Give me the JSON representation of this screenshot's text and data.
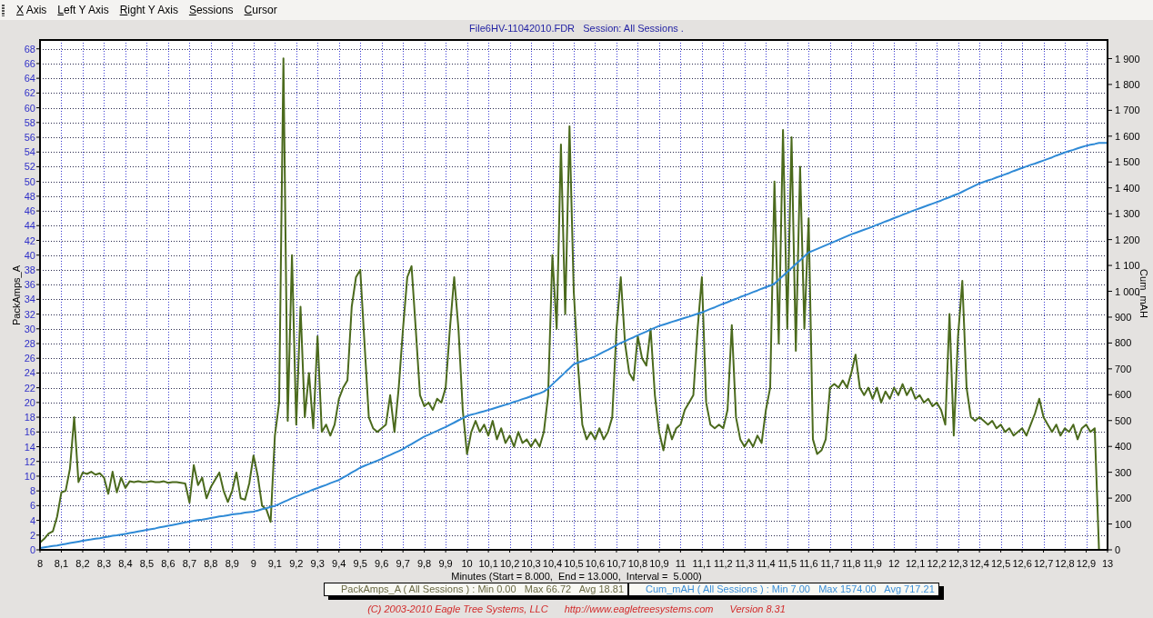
{
  "menu_bar": [
    "X Axis",
    "Left Y Axis",
    "Right Y Axis",
    "Sessions",
    "Cursor"
  ],
  "chart": {
    "chart_data": {
      "type": "line",
      "title": "File6HV-11042010.FDR   Session: All Sessions .",
      "xlabel": "Minutes (Start = 8.000,  End = 13.000,  Interval =  5.000)",
      "ylabel": "PackAmps_A",
      "y2label": "Cum_mAH",
      "grid": true,
      "xlim": [
        8,
        13
      ],
      "ylim": [
        0,
        69.2
      ],
      "y2lim": [
        0,
        1972
      ],
      "xticks": [
        8,
        {
          "value": 8.1,
          "label": "8,1"
        },
        {
          "value": 8.2,
          "label": "8,2"
        },
        {
          "value": 8.3,
          "label": "8,3"
        },
        {
          "value": 8.4,
          "label": "8,4"
        },
        {
          "value": 8.5,
          "label": "8,5"
        },
        {
          "value": 8.6,
          "label": "8,6"
        },
        {
          "value": 8.7,
          "label": "8,7"
        },
        {
          "value": 8.8,
          "label": "8,8"
        },
        {
          "value": 8.9,
          "label": "8,9"
        },
        9,
        {
          "value": 9.1,
          "label": "9,1"
        },
        {
          "value": 9.2,
          "label": "9,2"
        },
        {
          "value": 9.3,
          "label": "9,3"
        },
        {
          "value": 9.4,
          "label": "9,4"
        },
        {
          "value": 9.5,
          "label": "9,5"
        },
        {
          "value": 9.6,
          "label": "9,6"
        },
        {
          "value": 9.7,
          "label": "9,7"
        },
        {
          "value": 9.8,
          "label": "9,8"
        },
        {
          "value": 9.9,
          "label": "9,9"
        },
        10,
        {
          "value": 10.1,
          "label": "10,1"
        },
        {
          "value": 10.2,
          "label": "10,2"
        },
        {
          "value": 10.3,
          "label": "10,3"
        },
        {
          "value": 10.4,
          "label": "10,4"
        },
        {
          "value": 10.5,
          "label": "10,5"
        },
        {
          "value": 10.6,
          "label": "10,6"
        },
        {
          "value": 10.7,
          "label": "10,7"
        },
        {
          "value": 10.8,
          "label": "10,8"
        },
        {
          "value": 10.9,
          "label": "10,9"
        },
        11,
        {
          "value": 11.1,
          "label": "11,1"
        },
        {
          "value": 11.2,
          "label": "11,2"
        },
        {
          "value": 11.3,
          "label": "11,3"
        },
        {
          "value": 11.4,
          "label": "11,4"
        },
        {
          "value": 11.5,
          "label": "11,5"
        },
        {
          "value": 11.6,
          "label": "11,6"
        },
        {
          "value": 11.7,
          "label": "11,7"
        },
        {
          "value": 11.8,
          "label": "11,8"
        },
        {
          "value": 11.9,
          "label": "11,9"
        },
        12,
        {
          "value": 12.1,
          "label": "12,1"
        },
        {
          "value": 12.2,
          "label": "12,2"
        },
        {
          "value": 12.3,
          "label": "12,3"
        },
        {
          "value": 12.4,
          "label": "12,4"
        },
        {
          "value": 12.5,
          "label": "12,5"
        },
        {
          "value": 12.6,
          "label": "12,6"
        },
        {
          "value": 12.7,
          "label": "12,7"
        },
        {
          "value": 12.8,
          "label": "12,8"
        },
        {
          "value": 12.9,
          "label": "12,9"
        },
        13
      ],
      "yticks": [
        0,
        2,
        4,
        6,
        8,
        10,
        12,
        14,
        16,
        18,
        20,
        22,
        24,
        26,
        28,
        30,
        32,
        34,
        36,
        38,
        40,
        42,
        44,
        46,
        48,
        50,
        52,
        54,
        56,
        58,
        60,
        62,
        64,
        66,
        68
      ],
      "y2ticks": [
        0,
        100,
        200,
        300,
        400,
        500,
        600,
        700,
        800,
        900,
        {
          "value": 1000,
          "label": "1 000"
        },
        {
          "value": 1100,
          "label": "1 100"
        },
        {
          "value": 1200,
          "label": "1 200"
        },
        {
          "value": 1300,
          "label": "1 300"
        },
        {
          "value": 1400,
          "label": "1 400"
        },
        {
          "value": 1500,
          "label": "1 500"
        },
        {
          "value": 1600,
          "label": "1 600"
        },
        {
          "value": 1700,
          "label": "1 700"
        },
        {
          "value": 1800,
          "label": "1 800"
        },
        {
          "value": 1900,
          "label": "1 900"
        }
      ],
      "x": [
        8,
        8.02,
        8.04,
        8.06,
        8.08,
        8.1,
        8.12,
        8.14,
        8.16,
        8.18,
        8.2,
        8.22,
        8.24,
        8.26,
        8.28,
        8.3,
        8.32,
        8.34,
        8.36,
        8.38,
        8.4,
        8.42,
        8.44,
        8.46,
        8.48,
        8.5,
        8.52,
        8.54,
        8.56,
        8.58,
        8.6,
        8.62,
        8.64,
        8.66,
        8.68,
        8.7,
        8.72,
        8.74,
        8.76,
        8.78,
        8.8,
        8.82,
        8.84,
        8.86,
        8.88,
        8.9,
        8.92,
        8.94,
        8.96,
        8.98,
        9,
        9.02,
        9.04,
        9.06,
        9.08,
        9.1,
        9.12,
        9.14,
        9.16,
        9.18,
        9.2,
        9.22,
        9.24,
        9.26,
        9.28,
        9.3,
        9.32,
        9.34,
        9.36,
        9.38,
        9.4,
        9.42,
        9.44,
        9.46,
        9.48,
        9.5,
        9.52,
        9.54,
        9.56,
        9.58,
        9.6,
        9.62,
        9.64,
        9.66,
        9.68,
        9.7,
        9.72,
        9.74,
        9.76,
        9.78,
        9.8,
        9.82,
        9.84,
        9.86,
        9.88,
        9.9,
        9.92,
        9.94,
        9.96,
        9.98,
        10,
        10.02,
        10.04,
        10.06,
        10.08,
        10.1,
        10.12,
        10.14,
        10.16,
        10.18,
        10.2,
        10.22,
        10.24,
        10.26,
        10.28,
        10.3,
        10.32,
        10.34,
        10.36,
        10.38,
        10.4,
        10.42,
        10.44,
        10.46,
        10.48,
        10.5,
        10.52,
        10.54,
        10.56,
        10.58,
        10.6,
        10.62,
        10.64,
        10.66,
        10.68,
        10.7,
        10.72,
        10.74,
        10.76,
        10.78,
        10.8,
        10.82,
        10.84,
        10.86,
        10.88,
        10.9,
        10.92,
        10.94,
        10.96,
        10.98,
        11,
        11.02,
        11.04,
        11.06,
        11.08,
        11.1,
        11.12,
        11.14,
        11.16,
        11.18,
        11.2,
        11.22,
        11.24,
        11.26,
        11.28,
        11.3,
        11.32,
        11.34,
        11.36,
        11.38,
        11.4,
        11.42,
        11.44,
        11.46,
        11.48,
        11.5,
        11.52,
        11.54,
        11.56,
        11.58,
        11.6,
        11.62,
        11.64,
        11.66,
        11.68,
        11.7,
        11.72,
        11.74,
        11.76,
        11.78,
        11.8,
        11.82,
        11.84,
        11.86,
        11.88,
        11.9,
        11.92,
        11.94,
        11.96,
        11.98,
        12,
        12.02,
        12.04,
        12.06,
        12.08,
        12.1,
        12.12,
        12.14,
        12.16,
        12.18,
        12.2,
        12.22,
        12.24,
        12.26,
        12.28,
        12.3,
        12.32,
        12.34,
        12.36,
        12.38,
        12.4,
        12.42,
        12.44,
        12.46,
        12.48,
        12.5,
        12.52,
        12.54,
        12.56,
        12.58,
        12.6,
        12.62,
        12.64,
        12.66,
        12.68,
        12.7,
        12.72,
        12.74,
        12.76,
        12.78,
        12.8,
        12.82,
        12.84,
        12.86,
        12.88,
        12.9,
        12.92,
        12.94,
        12.96,
        12.98,
        13
      ],
      "series": [
        {
          "color": "#4b6a1d",
          "values": [
            1,
            1.5,
            2.2,
            2.5,
            4.5,
            7.8,
            8,
            11,
            18,
            9.2,
            10.5,
            10.3,
            10.6,
            10.2,
            10.4,
            9.8,
            7.6,
            10.6,
            7.8,
            9.8,
            8.4,
            9.3,
            9.2,
            9.3,
            9.2,
            9.2,
            9.3,
            9.2,
            9.2,
            9.3,
            9.1,
            9.2,
            9.2,
            9.1,
            9,
            6.4,
            11.5,
            8.8,
            9.8,
            7,
            8.5,
            9.5,
            10.5,
            8,
            6.5,
            8,
            10.5,
            7,
            6.8,
            9,
            12.8,
            10,
            6,
            5.5,
            3.8,
            15.5,
            20,
            66.7,
            17.5,
            40,
            17,
            33,
            18,
            24,
            16.5,
            29,
            16,
            17,
            15.5,
            17,
            20.5,
            22,
            23,
            33,
            37,
            38,
            28,
            18,
            16.5,
            16,
            16.5,
            17,
            21,
            16,
            22,
            30,
            37,
            38.5,
            30,
            21,
            19.5,
            20,
            19,
            20.5,
            20,
            22,
            30,
            37,
            30,
            19,
            13,
            16,
            17.5,
            16,
            17,
            15.5,
            17.5,
            15,
            16.5,
            14.5,
            15.5,
            14,
            16,
            14.5,
            15,
            14,
            15,
            14,
            16,
            21,
            40,
            30,
            55,
            32,
            57.5,
            35,
            25,
            17,
            15,
            16,
            15,
            16.5,
            15,
            16,
            18,
            30,
            37,
            28,
            24,
            23,
            29,
            26,
            25,
            30,
            21,
            16,
            13.5,
            17,
            15,
            16.5,
            17,
            19,
            20,
            21,
            30,
            37,
            20,
            17,
            16.5,
            17,
            16.5,
            19,
            30.5,
            18,
            15,
            14,
            15,
            14,
            15.5,
            14.5,
            19,
            22,
            50,
            28,
            57,
            30,
            56,
            27,
            52,
            30,
            45,
            15,
            13,
            13.5,
            15,
            22,
            22.5,
            22,
            23,
            22,
            24,
            26.5,
            22,
            21,
            22,
            20.5,
            22,
            20,
            21.5,
            20.5,
            22,
            21,
            22.5,
            21,
            22,
            20.5,
            21,
            20,
            20.5,
            19.5,
            20,
            19,
            17,
            32,
            15.5,
            29,
            36.5,
            22,
            18,
            17.5,
            18,
            17.5,
            17,
            17.5,
            16.5,
            17,
            16,
            16.5,
            15.5,
            16,
            16.5,
            15.5,
            17,
            18.5,
            20.5,
            18,
            17,
            16,
            17,
            15.5,
            16.5,
            16,
            17,
            15,
            16.5,
            17,
            16,
            16.5,
            0,
            null,
            null
          ]
        },
        {
          "color": "#2f8ad6",
          "axis": "y2",
          "values": [
            7,
            10,
            12,
            15,
            17,
            20,
            23,
            26,
            29,
            32,
            35,
            38,
            40,
            43,
            45,
            48,
            51,
            54,
            56,
            59,
            62,
            65,
            68,
            71,
            74,
            77,
            80,
            83,
            87,
            90,
            93,
            96,
            99,
            103,
            106,
            109,
            112,
            115,
            117,
            120,
            123,
            126,
            129,
            131,
            134,
            137,
            139,
            141,
            144,
            146,
            148,
            152,
            157,
            161,
            166,
            170,
            177,
            185,
            192,
            200,
            207,
            213,
            220,
            226,
            233,
            239,
            245,
            251,
            258,
            264,
            270,
            280,
            289,
            299,
            308,
            318,
            325,
            332,
            338,
            345,
            352,
            360,
            367,
            375,
            382,
            390,
            400,
            409,
            419,
            428,
            438,
            445,
            453,
            460,
            468,
            475,
            484,
            492,
            501,
            509,
            518,
            523,
            527,
            532,
            536,
            541,
            546,
            551,
            556,
            561,
            566,
            572,
            577,
            583,
            588,
            594,
            600,
            605,
            612,
            624,
            640,
            656,
            671,
            687,
            702,
            718,
            724,
            730,
            736,
            742,
            748,
            757,
            766,
            774,
            783,
            792,
            800,
            807,
            815,
            822,
            830,
            837,
            844,
            852,
            859,
            866,
            871,
            876,
            882,
            887,
            892,
            897,
            902,
            908,
            913,
            918,
            925,
            932,
            938,
            945,
            952,
            958,
            965,
            971,
            978,
            984,
            990,
            997,
            1003,
            1010,
            1016,
            1022,
            1030,
            1045,
            1060,
            1075,
            1090,
            1105,
            1120,
            1135,
            1150,
            1157,
            1164,
            1171,
            1178,
            1185,
            1192,
            1199,
            1206,
            1213,
            1220,
            1226,
            1232,
            1238,
            1244,
            1250,
            1257,
            1263,
            1270,
            1276,
            1283,
            1289,
            1296,
            1302,
            1309,
            1315,
            1321,
            1327,
            1333,
            1339,
            1345,
            1351,
            1358,
            1364,
            1371,
            1377,
            1385,
            1393,
            1401,
            1409,
            1417,
            1423,
            1429,
            1434,
            1440,
            1446,
            1452,
            1458,
            1465,
            1471,
            1477,
            1483,
            1489,
            1494,
            1500,
            1506,
            1512,
            1518,
            1525,
            1531,
            1537,
            1542,
            1547,
            1553,
            1558,
            1563,
            1567,
            1570,
            1574,
            1574,
            1574
          ]
        }
      ]
    },
    "legend": [
      {
        "text": "PackAmps_A ( All Sessions ) : Min 0.00   Max 66.72   Avg 18.81",
        "color": "#6b6b46"
      },
      {
        "text": "Cum_mAH ( All Sessions ) : Min 7.00   Max 1574.00   Avg 717.21",
        "color": "#3b8fd9"
      }
    ]
  },
  "footer": {
    "copyright": "(C) 2003-2010 Eagle Tree Systems, LLC",
    "url": "http://www.eagletreesystems.com",
    "version": "Version 8.31"
  }
}
